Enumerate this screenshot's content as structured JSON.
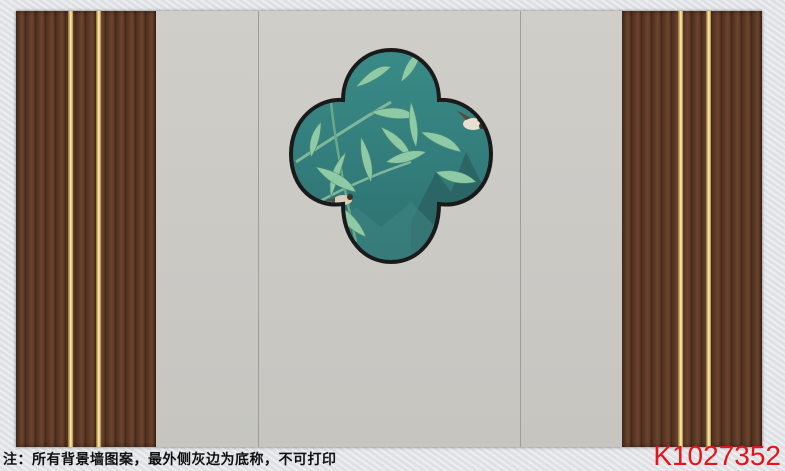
{
  "note_text": "注：所有背景墙图案，最外侧灰边为底称，不可打印",
  "product_code": "K1027352",
  "colors": {
    "wood": "#5d3a27",
    "gold_trim": "#f3d78a",
    "wall_gray": "#c9c8c3",
    "window_teal": "#2f7d7c",
    "frame_black": "#1a1a1a",
    "code_red": "#e3141b"
  },
  "artwork": {
    "subject": "bamboo-birds-mountains",
    "window_shape": "quatrefoil"
  }
}
